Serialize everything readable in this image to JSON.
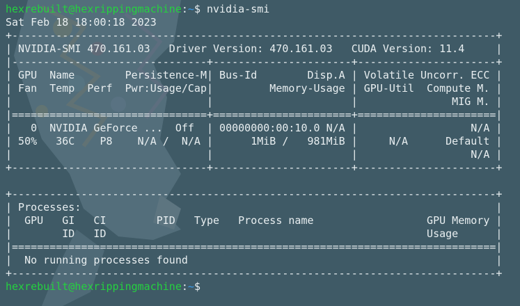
{
  "colors": {
    "background": "#3f5a66",
    "text": "#e8eef0",
    "prompt_user": "#25d13f",
    "prompt_path": "#3a9df0"
  },
  "prompt": {
    "user_host": "hexrebuilt@hexrippingmachine",
    "separator": ":",
    "path": "~",
    "symbol": "$"
  },
  "command": " nvidia-smi",
  "output": {
    "timestamp": "Sat Feb 18 18:00:18 2023",
    "lines": [
      "+-----------------------------------------------------------------------------+",
      "| NVIDIA-SMI 470.161.03   Driver Version: 470.161.03   CUDA Version: 11.4     |",
      "|-------------------------------+----------------------+----------------------+",
      "| GPU  Name        Persistence-M| Bus-Id        Disp.A | Volatile Uncorr. ECC |",
      "| Fan  Temp  Perf  Pwr:Usage/Cap|         Memory-Usage | GPU-Util  Compute M. |",
      "|                               |                      |               MIG M. |",
      "|===============================+======================+======================|",
      "|   0  NVIDIA GeForce ...  Off  | 00000000:00:10.0 N/A |                  N/A |",
      "| 50%   36C    P8    N/A /  N/A |      1MiB /   981MiB |     N/A      Default |",
      "|                               |                      |                  N/A |",
      "+-------------------------------+----------------------+----------------------+",
      "",
      "+-----------------------------------------------------------------------------+",
      "| Processes:                                                                  |",
      "|  GPU   GI   CI        PID   Type   Process name                  GPU Memory |",
      "|        ID   ID                                                   Usage      |",
      "|=============================================================================|",
      "|  No running processes found                                                 |",
      "+-----------------------------------------------------------------------------+"
    ]
  }
}
